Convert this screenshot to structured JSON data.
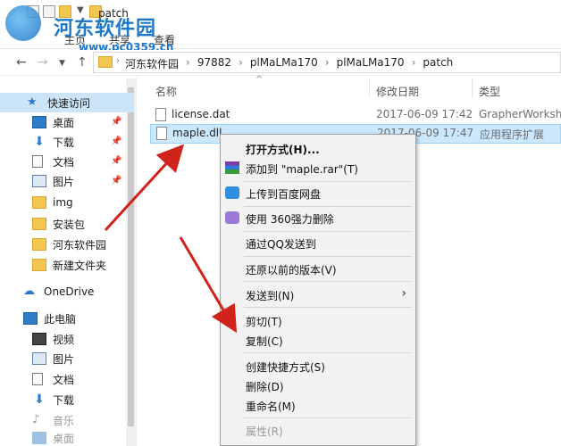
{
  "ribbon": {
    "tab_home": "主页",
    "tab_share": "共享",
    "tab_view": "查看",
    "window_title": "patch"
  },
  "watermark": {
    "title": "河东软件园",
    "url": "www.pc0359.cn"
  },
  "address": {
    "crumbs": [
      "河东软件园",
      "97882",
      "plMaLMa170",
      "plMaLMa170",
      "patch"
    ]
  },
  "sidebar": {
    "items": [
      {
        "label": "快速访问",
        "icon": "star-icon"
      },
      {
        "label": "桌面",
        "icon": "desktop-icon"
      },
      {
        "label": "下载",
        "icon": "download-icon"
      },
      {
        "label": "文档",
        "icon": "document-icon"
      },
      {
        "label": "图片",
        "icon": "picture-icon"
      },
      {
        "label": "img",
        "icon": "folder-icon"
      },
      {
        "label": "安装包",
        "icon": "folder-icon"
      },
      {
        "label": "河东软件园",
        "icon": "folder-icon"
      },
      {
        "label": "新建文件夹",
        "icon": "folder-icon"
      },
      {
        "label": "OneDrive",
        "icon": "cloud-icon"
      },
      {
        "label": "此电脑",
        "icon": "computer-icon"
      },
      {
        "label": "视频",
        "icon": "video-icon"
      },
      {
        "label": "图片",
        "icon": "picture-icon"
      },
      {
        "label": "文档",
        "icon": "document-icon"
      },
      {
        "label": "下载",
        "icon": "download-icon"
      },
      {
        "label": "音乐",
        "icon": "music-icon"
      },
      {
        "label": "桌面",
        "icon": "desktop-icon"
      }
    ]
  },
  "columns": {
    "name": "名称",
    "date": "修改日期",
    "type": "类型"
  },
  "files": [
    {
      "name": "license.dat",
      "date": "2017-06-09 17:42",
      "type": "GrapherWorksh..."
    },
    {
      "name": "maple.dll",
      "date": "2017-06-09 17:47",
      "type": "应用程序扩展"
    }
  ],
  "menu": {
    "open_with": "打开方式(H)...",
    "add_rar": "添加到 \"maple.rar\"(T)",
    "baidu": "上传到百度网盘",
    "force_delete": "使用 360强力删除",
    "qq_send": "通过QQ发送到",
    "restore": "还原以前的版本(V)",
    "send_to": "发送到(N)",
    "cut": "剪切(T)",
    "copy": "复制(C)",
    "shortcut": "创建快捷方式(S)",
    "delete": "删除(D)",
    "rename": "重命名(M)",
    "properties": "属性(R)"
  },
  "colors": {
    "selection": "#cce8ff",
    "accent": "#1e78c8",
    "arrow": "#d0231b"
  }
}
